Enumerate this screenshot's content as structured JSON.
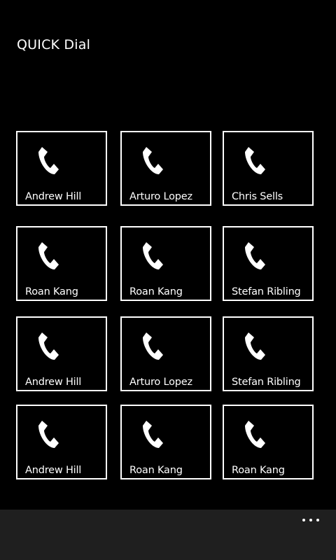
{
  "app": {
    "title": "QUICK Dial"
  },
  "contacts": [
    {
      "name": "Andrew Hill"
    },
    {
      "name": "Arturo Lopez"
    },
    {
      "name": "Chris Sells"
    },
    {
      "name": "Roan Kang"
    },
    {
      "name": "Roan Kang"
    },
    {
      "name": "Stefan Ribling"
    },
    {
      "name": "Andrew Hill"
    },
    {
      "name": "Arturo Lopez"
    },
    {
      "name": "Stefan Ribling"
    },
    {
      "name": "Andrew Hill"
    },
    {
      "name": "Roan Kang"
    },
    {
      "name": "Roan Kang"
    }
  ],
  "icons": {
    "tile_icon": "phone-icon",
    "app_bar_icon": "more-icon"
  },
  "colors": {
    "background": "#000000",
    "foreground": "#ffffff",
    "app_bar": "#1f1f1f"
  }
}
